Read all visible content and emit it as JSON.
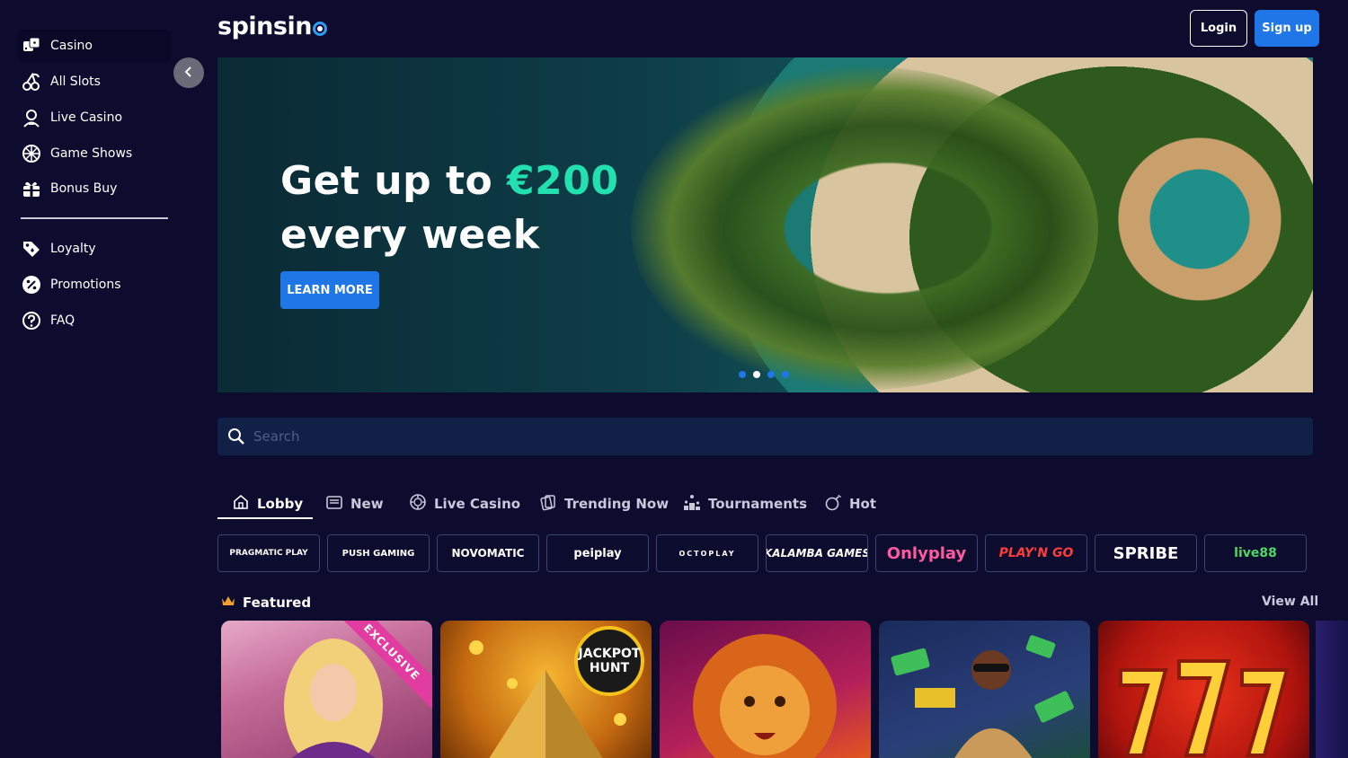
{
  "brand": {
    "logo_text": "spinsin"
  },
  "header": {
    "login_label": "Login",
    "signup_label": "Sign up"
  },
  "sidebar": {
    "items": [
      {
        "label": "Casino",
        "icon": "dice-icon"
      },
      {
        "label": "All Slots",
        "icon": "cherries-icon"
      },
      {
        "label": "Live Casino",
        "icon": "dealer-icon"
      },
      {
        "label": "Game Shows",
        "icon": "wheel-icon"
      },
      {
        "label": "Bonus Buy",
        "icon": "gift-icon"
      },
      {
        "label": "Loyalty",
        "icon": "tag-icon"
      },
      {
        "label": "Promotions",
        "icon": "percent-icon"
      },
      {
        "label": "FAQ",
        "icon": "question-icon"
      }
    ]
  },
  "hero": {
    "title_prefix": "Get up to ",
    "title_amount": "€200",
    "title_suffix": "every week",
    "button_label": "LEARN MORE",
    "slide_count": 4,
    "active_slide": 2
  },
  "search": {
    "placeholder": "Search"
  },
  "tabs": [
    {
      "label": "Lobby",
      "icon": "home-icon",
      "active": true
    },
    {
      "label": "New",
      "icon": "slot-machine-icon"
    },
    {
      "label": "Live Casino",
      "icon": "chip-icon"
    },
    {
      "label": "Trending Now",
      "icon": "cards-icon"
    },
    {
      "label": "Tournaments",
      "icon": "podium-icon"
    },
    {
      "label": "Hot",
      "icon": "bomb-icon"
    }
  ],
  "providers": [
    {
      "label": "PRAGMATIC PLAY"
    },
    {
      "label": "PUSH GAMING"
    },
    {
      "label": "NOVOMATIC"
    },
    {
      "label": "peiplay"
    },
    {
      "label": "OCTOPLAY"
    },
    {
      "label": "KALAMBA GAMES"
    },
    {
      "label": "Onlyplay"
    },
    {
      "label": "PLAY'N GO"
    },
    {
      "label": "SPRIBE"
    },
    {
      "label": "live88"
    }
  ],
  "featured": {
    "title": "Featured",
    "view_all": "View All",
    "cards": [
      {
        "name": "lady-portrait-game",
        "ribbon": "EXCLUSIVE"
      },
      {
        "name": "pyramid-game",
        "badge": "JACKPOT HUNT"
      },
      {
        "name": "lion-game"
      },
      {
        "name": "money-rapper-game"
      },
      {
        "name": "triple-seven-game"
      }
    ]
  },
  "colors": {
    "background": "#0d0b2e",
    "accent_blue": "#1f76e6",
    "accent_green": "#22e0b0"
  }
}
